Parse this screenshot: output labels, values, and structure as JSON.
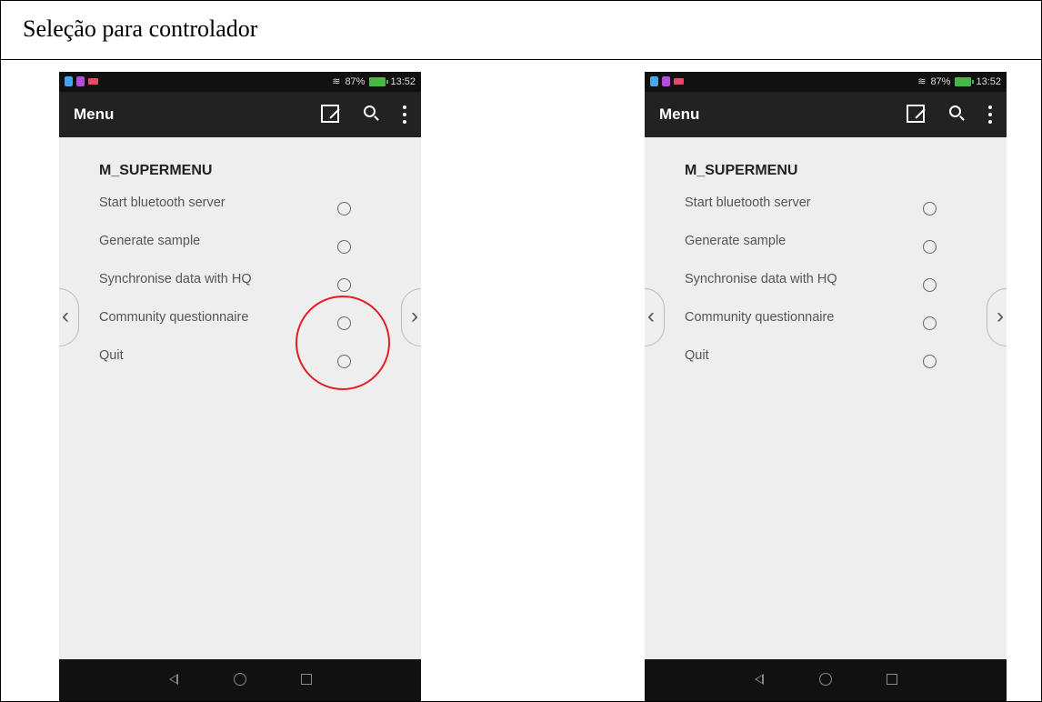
{
  "document": {
    "title": "Seleção para controlador"
  },
  "phones": [
    {
      "status_bar": {
        "battery_percent": "87%",
        "time": "13:52"
      },
      "app_bar": {
        "title": "Menu"
      },
      "menu": {
        "heading": "M_SUPERMENU",
        "items": [
          {
            "label": "Start bluetooth server",
            "selected": false
          },
          {
            "label": "Generate sample",
            "selected": false
          },
          {
            "label": "Synchronise data with HQ",
            "selected": false
          },
          {
            "label": "Community questionnaire",
            "selected": false
          },
          {
            "label": "Quit",
            "selected": false
          }
        ]
      },
      "nav": {
        "prev": "‹",
        "next": "›"
      },
      "annotation": {
        "highlight_color": "#e31e24",
        "highlight_around": [
          "Generate sample",
          "Synchronise data with HQ",
          "Community questionnaire"
        ]
      }
    },
    {
      "status_bar": {
        "battery_percent": "87%",
        "time": "13:52"
      },
      "app_bar": {
        "title": "Menu"
      },
      "menu": {
        "heading": "M_SUPERMENU",
        "items": [
          {
            "label": "Start bluetooth server",
            "selected": false
          },
          {
            "label": "Generate sample",
            "selected": false
          },
          {
            "label": "Synchronise data with HQ",
            "selected": false
          },
          {
            "label": "Community questionnaire",
            "selected": false
          },
          {
            "label": "Quit",
            "selected": false
          }
        ]
      },
      "nav": {
        "prev": "‹",
        "next": "›"
      }
    }
  ],
  "colors": {
    "status_bar_bg": "#111111",
    "app_bar_bg": "#222222",
    "content_bg": "#eeeeee",
    "battery": "#46b84a",
    "highlight": "#e31e24"
  }
}
